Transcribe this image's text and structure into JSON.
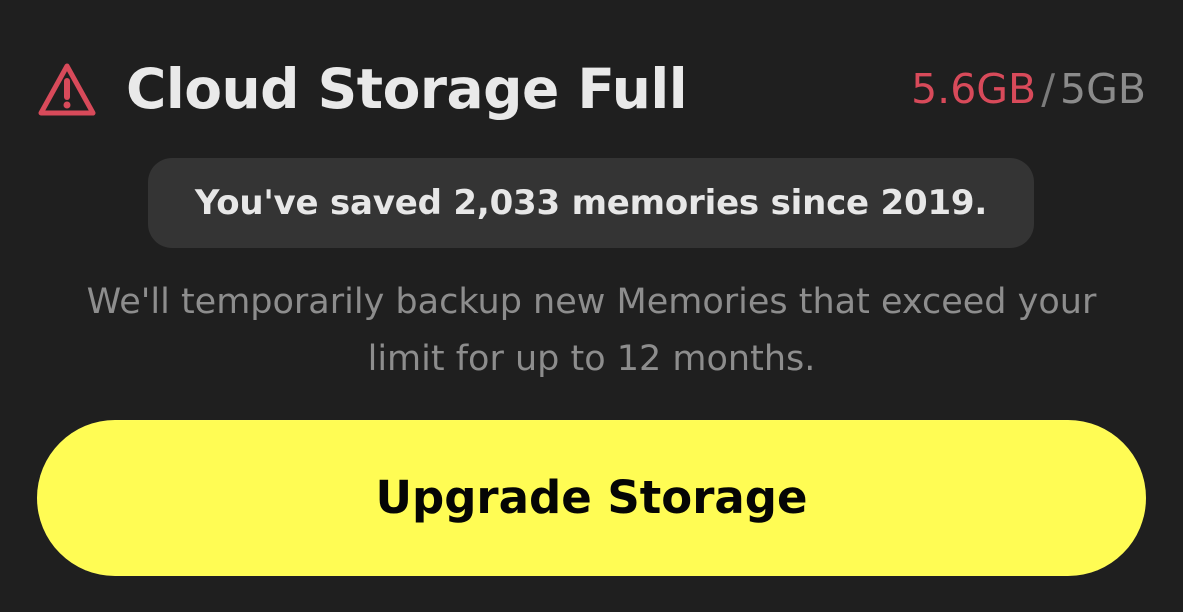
{
  "dialog": {
    "title": "Cloud Storage Full",
    "icon": "warning-icon",
    "usage": {
      "used": "5.6GB",
      "separator": "/",
      "limit": "5GB"
    },
    "memory_summary": "You've saved 2,033 memories since 2019.",
    "message": "We'll temporarily backup new Memories that exceed your limit for up to 12 months.",
    "upgrade_button_label": "Upgrade Storage"
  },
  "colors": {
    "background": "#1f1f1f",
    "alert": "#d84a5a",
    "accent": "#fffc54",
    "chip_background": "#343434"
  }
}
